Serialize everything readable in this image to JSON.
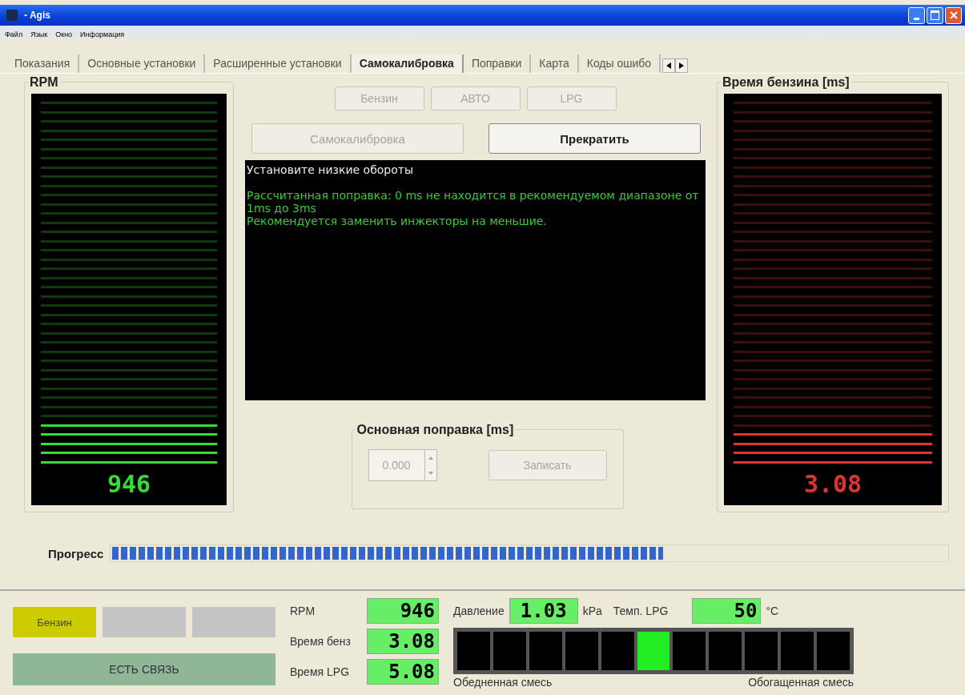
{
  "window": {
    "title": "- Agis"
  },
  "menu": [
    "Файл",
    "Язык",
    "Окно",
    "Информация"
  ],
  "tabs": [
    {
      "label": "Показания",
      "selected": false
    },
    {
      "label": "Основные установки",
      "selected": false
    },
    {
      "label": "Расширенные установки",
      "selected": false
    },
    {
      "label": "Самокалибровка",
      "selected": true
    },
    {
      "label": "Поправки",
      "selected": false
    },
    {
      "label": "Карта",
      "selected": false
    },
    {
      "label": "Коды ошибо",
      "selected": false
    }
  ],
  "gauges": [
    {
      "title": "RPM",
      "level": 0.13,
      "reading": "946",
      "color": "#33dd33"
    },
    {
      "title": "Время бензина [ms]",
      "level": 0.1,
      "reading": "3.08",
      "color": "#dd3333"
    }
  ],
  "fuel_modes": [
    {
      "label": "Бензин",
      "disabled": true
    },
    {
      "label": "АВТО",
      "disabled": true
    },
    {
      "label": "LPG",
      "disabled": true
    }
  ],
  "calibrate_button": {
    "label": "Самокалибровка",
    "disabled": true
  },
  "stop_button": {
    "label": "Прекратить",
    "disabled": false
  },
  "log": [
    {
      "kind": "info",
      "text": "Установите низкие обороты"
    },
    {
      "kind": "blank"
    },
    {
      "kind": "result",
      "text": "Рассчитанная поправка: 0 ms не находится в рекомендуемом диапазоне от 1ms до 3ms"
    },
    {
      "kind": "result",
      "text": "Рекомендуется заменить инжекторы на меньшие."
    }
  ],
  "correction": {
    "title": "Основная поправка [ms]",
    "value": "0.000",
    "disabled": true,
    "write_button": {
      "label": "Записать",
      "disabled": true
    }
  },
  "progress": {
    "label": "Прогресс",
    "level": 0.66
  },
  "status": {
    "fuel_indicators": [
      {
        "label": "Бензин",
        "on": true
      },
      {
        "on": false
      },
      {
        "on": false
      }
    ],
    "connection": "ЕСТЬ СВЯЗЬ",
    "readings": [
      {
        "label": "RPM",
        "value": "946"
      },
      {
        "label": "Время бенз",
        "value": "3.08"
      },
      {
        "label": "Время LPG",
        "value": "5.08"
      }
    ],
    "pressure": {
      "label": "Давление",
      "value": "1.03",
      "unit": "kPa"
    },
    "temperature": {
      "label": "Темп. LPG",
      "value": "50",
      "unit": "°C"
    },
    "mixture": {
      "cells": [
        {
          "on": false
        },
        {
          "on": false
        },
        {
          "on": false
        },
        {
          "on": false
        },
        {
          "on": false
        },
        {
          "on": true
        },
        {
          "on": false
        },
        {
          "on": false
        },
        {
          "on": false
        },
        {
          "on": false
        },
        {
          "on": false
        }
      ],
      "lean_label": "Обедненная смесь",
      "rich_label": "Обогащенная смесь"
    }
  }
}
